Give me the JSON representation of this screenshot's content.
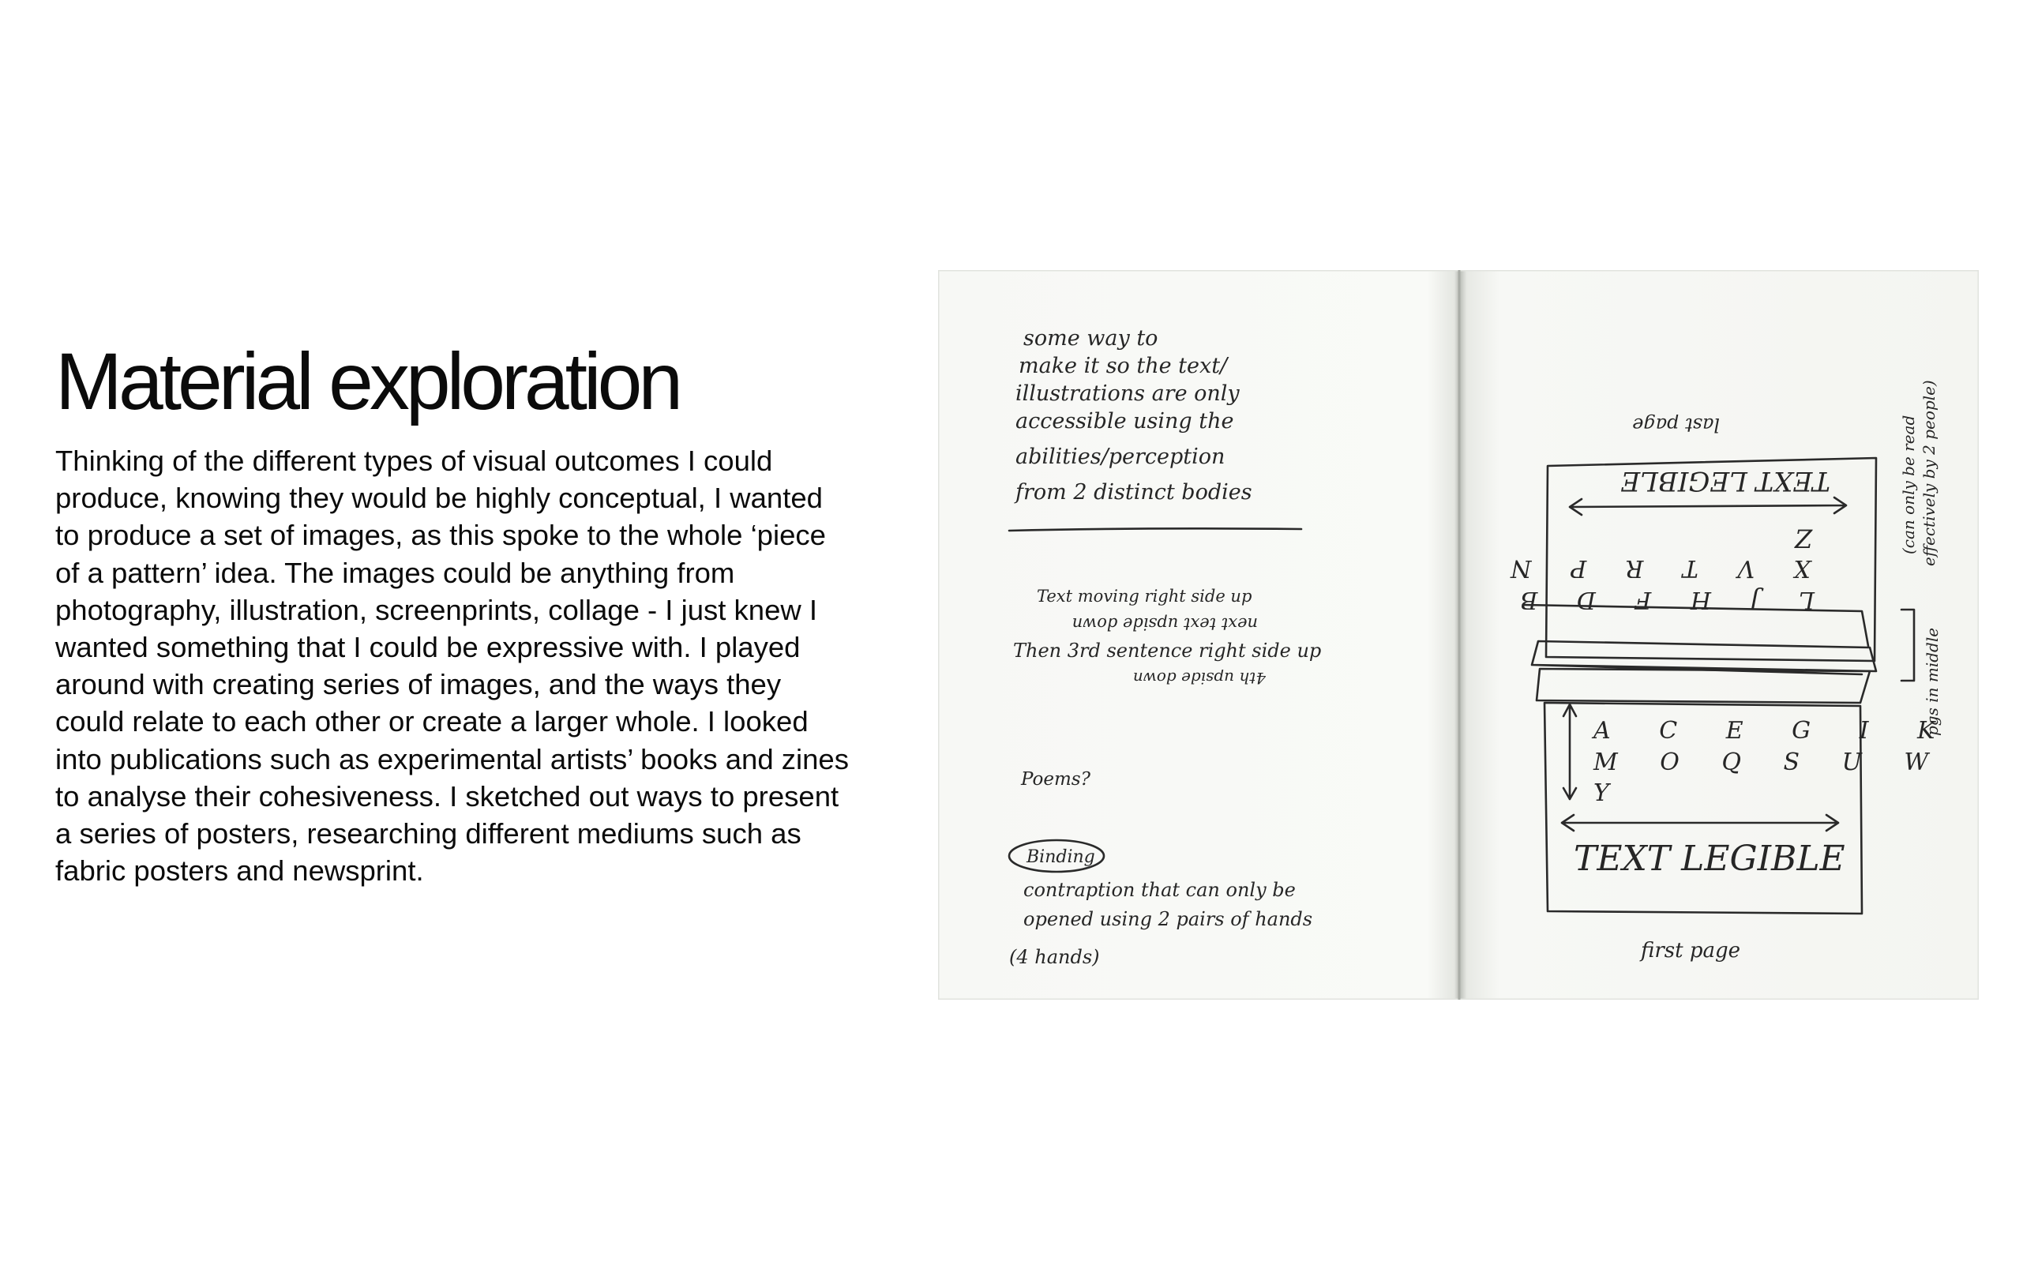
{
  "page": {
    "title": "Material exploration",
    "body": "Thinking of the different types of visual outcomes I could produce, knowing they would be highly conceptual, I wanted to produce a set of images, as this spoke to the whole ‘piece of a pattern’ idea. The images could be anything from photography, illustration, screenprints, collage - I just knew I wanted something that I could be expressive with. I played around with creating series of images, and the ways they could relate to each other or create a larger whole. I looked into publications such as experimental artists’ books and zines to analyse their cohesiveness. I sketched out ways to present a series of posters, researching different mediums such as fabric posters and newsprint."
  },
  "sketch": {
    "left_page": {
      "note_1": [
        "some way to",
        "make it so the text/",
        "illustrations are only",
        "accessible using the",
        "abilities/perception",
        "from 2 distinct bodies"
      ],
      "note_2": [
        "Text moving right side up",
        "next text upside down",
        "Then 3rd sentence right side up",
        "4th upside down"
      ],
      "poems": "Poems?",
      "binding": "Binding",
      "binding_note": [
        "contraption that can only be",
        "opened using 2 pairs of hands",
        "(4 hands)"
      ]
    },
    "right_page": {
      "last_page": "last page",
      "text_legible_flipped": "TEXT LEGIBLE",
      "top_letters_row1": [
        "Z"
      ],
      "top_letters_row2": [
        "X",
        "V",
        "T",
        "R",
        "P",
        "N"
      ],
      "top_letters_row3": [
        "L",
        "J",
        "H",
        "F",
        "D",
        "B"
      ],
      "bottom_letters_row1": [
        "A",
        "C",
        "E",
        "G",
        "I",
        "K"
      ],
      "bottom_letters_row2": [
        "M",
        "O",
        "Q",
        "S",
        "U",
        "W"
      ],
      "bottom_letters_row3": [
        "Y"
      ],
      "text_legible": "TEXT LEGIBLE",
      "first_page": "first page",
      "side_note": [
        "(can only be read",
        "effectively by 2 people)"
      ],
      "pgs_in_middle": "pgs in middle"
    }
  }
}
